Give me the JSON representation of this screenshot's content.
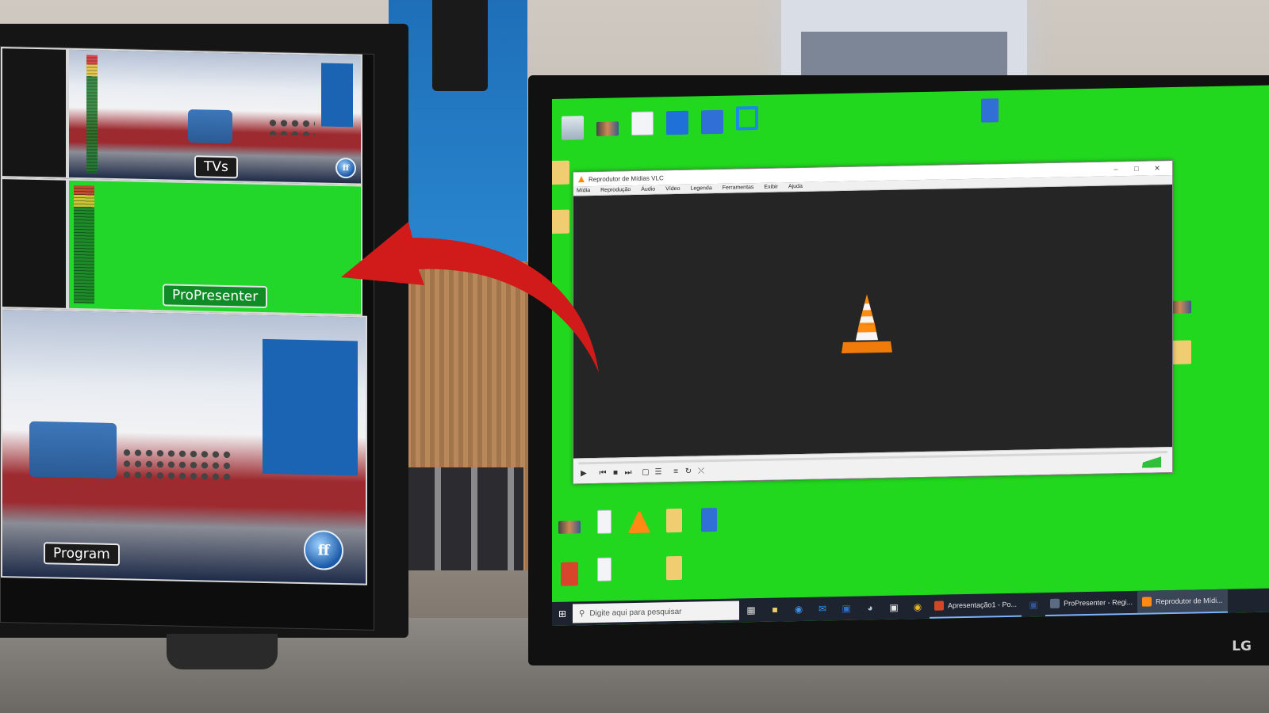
{
  "multiviewer": {
    "labels": {
      "tvs": "TVs",
      "propresenter": "ProPresenter",
      "program": "Program"
    }
  },
  "vlc_window": {
    "title": "Reprodutor de Mídias VLC",
    "menu": [
      "Mídia",
      "Reprodução",
      "Áudio",
      "Vídeo",
      "Legenda",
      "Ferramentas",
      "Exibir",
      "Ajuda"
    ],
    "controls": [
      "play-icon",
      "previous-icon",
      "stop-icon",
      "next-icon",
      "fullscreen-icon",
      "extended-settings-icon",
      "playlist-icon",
      "loop-icon",
      "shuffle-icon"
    ],
    "volume_percent": 100
  },
  "taskbar": {
    "search_placeholder": "Digite aqui para pesquisar",
    "apps": [
      {
        "label": "Apresentação1 - Po...",
        "color": "#d24726",
        "active": false
      },
      {
        "label": "ProPresenter - Regi...",
        "color": "#5b6b82",
        "active": false
      },
      {
        "label": "Reprodutor de Mídi...",
        "color": "#ff8a14",
        "active": true
      }
    ]
  },
  "monitor_brand": "LG",
  "colors": {
    "chroma_green": "#22d81f",
    "annotation_arrow": "#d11a1a"
  }
}
